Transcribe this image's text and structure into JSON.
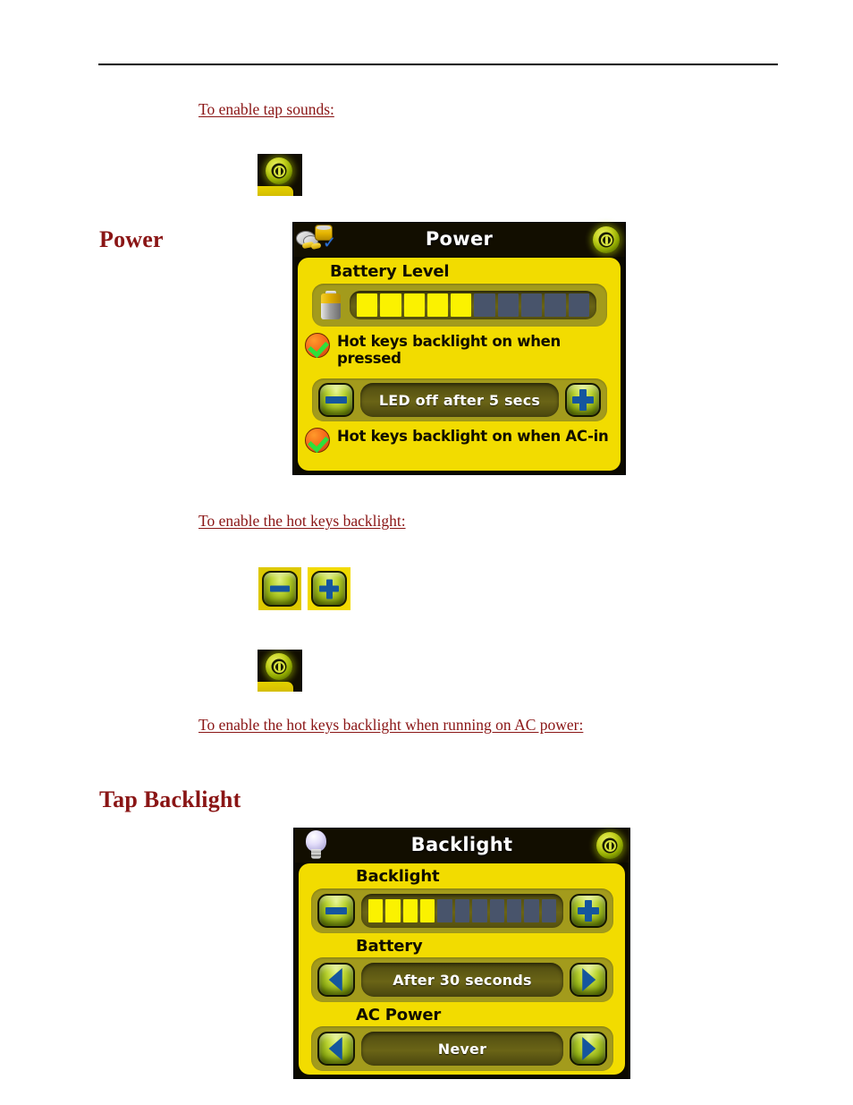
{
  "document": {
    "steps": [
      {
        "text": "To enable tap sounds:"
      },
      {
        "text": "To enable the hot keys backlight:"
      },
      {
        "text": "To enable the hot keys backlight when running on AC power:"
      }
    ],
    "headings": {
      "power": "Power",
      "tap_backlight": "Tap Backlight"
    },
    "colors": {
      "heading": "#8a1515",
      "link": "#8a1515",
      "rule": "#000000",
      "device_yellow": "#f2dc00",
      "device_black": "#0b0900",
      "meter_on": "#fbf200",
      "meter_off": "#48546b",
      "glyph_blue": "#15569e",
      "check_green": "#2ee03a",
      "check_orange": "#f4651a"
    }
  },
  "inline_icons": [
    {
      "name": "power-button-icon",
      "label": "Power button"
    },
    {
      "name": "minus-button-icon",
      "label": "Minus button"
    },
    {
      "name": "plus-button-icon",
      "label": "Plus button"
    },
    {
      "name": "power-button-icon-2",
      "label": "Power button"
    }
  ],
  "power_screen": {
    "title": "Power",
    "title_icon": "hot-keys-icon",
    "power_icon": "power-icon",
    "battery_group_label": "Battery Level",
    "battery_meter": {
      "segments_total": 10,
      "segments_filled": 5,
      "icon": "battery-icon"
    },
    "option_pressed": {
      "checked": true,
      "label": "Hot keys backlight on when pressed"
    },
    "led_timeout": {
      "minus_label": "minus",
      "plus_label": "plus",
      "value": "LED off after 5 secs"
    },
    "option_acin": {
      "checked": true,
      "label": "Hot keys backlight on when AC-in"
    }
  },
  "backlight_screen": {
    "title": "Backlight",
    "title_icon": "light-bulb-icon",
    "power_icon": "power-icon",
    "backlight_group_label": "Backlight",
    "backlight_meter": {
      "segments_total": 11,
      "segments_filled": 4
    },
    "battery_group_label": "Battery",
    "battery_timeout": {
      "value": "After 30 seconds"
    },
    "ac_power_group_label": "AC Power",
    "ac_power_timeout": {
      "value": "Never"
    }
  }
}
